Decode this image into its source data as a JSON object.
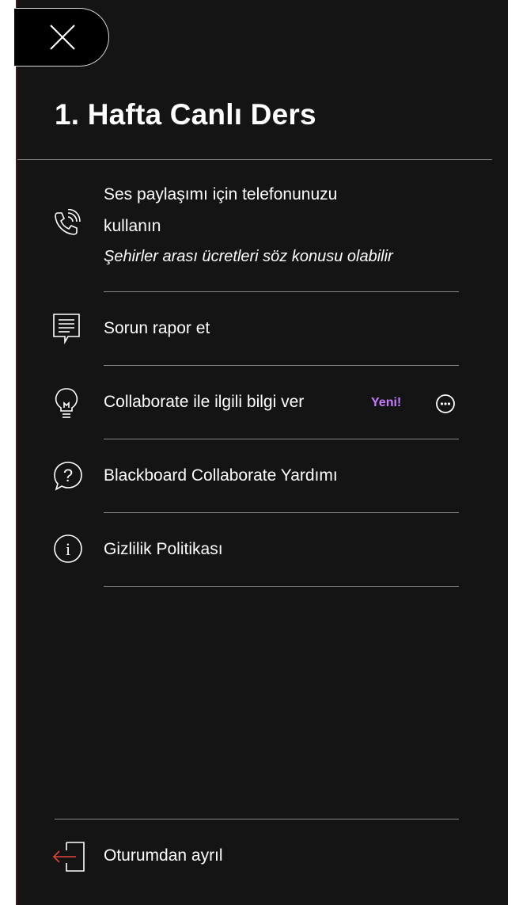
{
  "session": {
    "title": "1. Hafta Canlı Ders"
  },
  "close_button": {
    "icon": "close-icon"
  },
  "menu": {
    "phone": {
      "icon": "phone-icon",
      "line1": "Ses paylaşımı için telefonunuzu",
      "line2": "kullanın",
      "subtext": "Şehirler arası ücretleri söz konusu olabilir"
    },
    "report": {
      "icon": "report-icon",
      "label": "Sorun rapor et"
    },
    "feedback": {
      "icon": "lightbulb-icon",
      "label": "Collaborate ile ilgili bilgi ver",
      "badge": "Yeni!",
      "more_icon": "more-options-icon"
    },
    "help": {
      "icon": "help-icon",
      "label": "Blackboard Collaborate Yardımı"
    },
    "privacy": {
      "icon": "info-icon",
      "label": "Gizlilik Politikası"
    }
  },
  "leave": {
    "icon": "leave-session-icon",
    "label": "Oturumdan ayrıl"
  },
  "colors": {
    "panel_bg": "#141414",
    "badge": "#c77dff",
    "leave_arrow": "#e0453a"
  }
}
